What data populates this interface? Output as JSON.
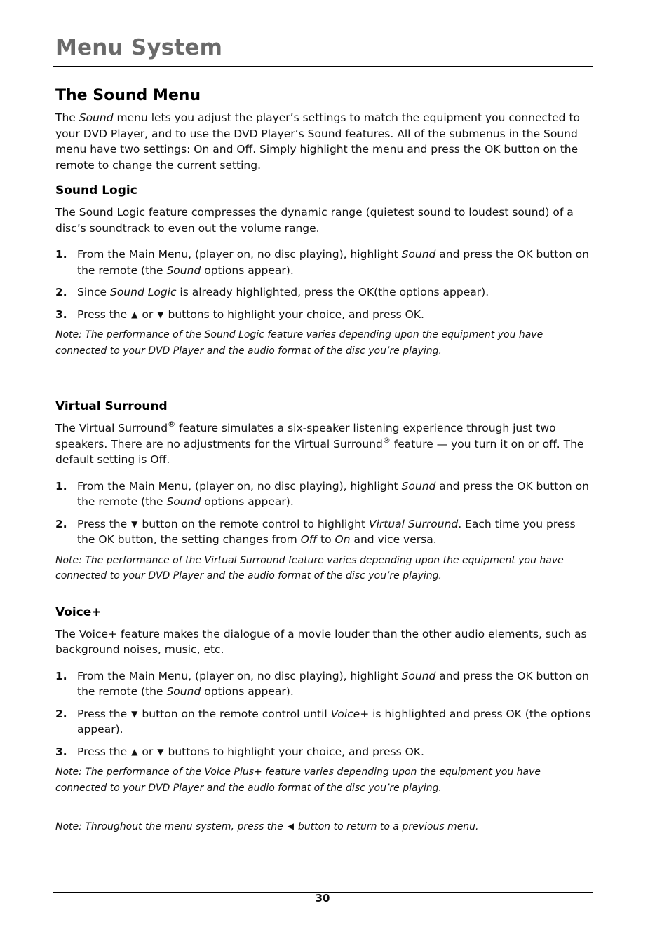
{
  "header": {
    "title": "Menu System"
  },
  "section": {
    "title": "The Sound Menu",
    "intro": {
      "p1": "The ",
      "p1_em": "Sound",
      "p1_rest": " menu lets you adjust the player’s settings to match the equipment you connected to your DVD Player, and to use the DVD Player’s Sound features. All of the submenus in the Sound menu have two settings: On and Off. Simply highlight the menu and press the OK button on the remote to change the current setting."
    }
  },
  "sound_logic": {
    "title": "Sound Logic",
    "description": "The Sound Logic feature compresses the dynamic range (quietest sound to loudest sound) of a disc’s soundtrack to even out the volume range.",
    "steps": [
      {
        "num": "1.",
        "a": "From the Main Menu, (player on, no disc playing), highlight ",
        "em1": "Sound",
        "b": " and press the OK button on the remote (the ",
        "em2": "Sound",
        "c": " options appear)."
      },
      {
        "num": "2.",
        "a": "Since ",
        "em1": "Sound Logic",
        "b": " is already highlighted, press the OK(the options appear)."
      },
      {
        "num": "3.",
        "a": "Press the",
        "mid": "or",
        "b": "buttons to highlight your choice, and press OK."
      }
    ],
    "note": "Note: The performance of the Sound Logic feature varies depending upon the equipment you have connected to your DVD Player and the audio format of the disc you’re playing."
  },
  "virtual_surround": {
    "title": "Virtual Surround",
    "desc_a": "The Virtual Surround",
    "desc_b": " feature simulates a six-speaker listening experience through just two speakers. There are no adjustments for the Virtual Surround",
    "desc_c": " feature — you turn it on or off. The default setting is Off.",
    "reg": "®",
    "steps": [
      {
        "num": "1.",
        "a": "From the Main Menu, (player on, no disc playing), highlight ",
        "em1": "Sound",
        "b": " and press the OK button on the remote (the ",
        "em2": "Sound",
        "c": " options appear)."
      },
      {
        "num": "2.",
        "a": "Press the",
        "b": "button on the remote control to highlight ",
        "em1": "Virtual Surround",
        "c": ". Each time you press the OK button, the setting changes from ",
        "em2": "Off",
        "d": " to ",
        "em3": "On",
        "e": " and vice versa."
      }
    ],
    "note": "Note: The performance of the Virtual Surround feature varies depending upon the equipment you have connected to your DVD Player and the audio format of the disc you’re playing."
  },
  "voice_plus": {
    "title": "Voice+",
    "description": "The Voice+ feature makes the dialogue of a movie louder than the other audio elements, such as background noises, music, etc.",
    "steps": [
      {
        "num": "1.",
        "a": "From the Main Menu, (player on, no disc playing), highlight ",
        "em1": "Sound",
        "b": " and press the OK button on the remote (the ",
        "em2": "Sound",
        "c": " options appear)."
      },
      {
        "num": "2.",
        "a": "Press the",
        "b": "button on the remote control until ",
        "em1": "Voice+",
        "c": " is highlighted and press OK (the options appear)."
      },
      {
        "num": "3.",
        "a": "Press the",
        "mid": "or",
        "b": "buttons to highlight your choice, and press OK."
      }
    ],
    "note": "Note: The performance of the Voice Plus+ feature varies depending upon the equipment you have connected to your DVD Player and the audio format of the disc you’re playing."
  },
  "final_note": {
    "a": "Note: Throughout the menu system, press the",
    "b": "button to return to a previous menu."
  },
  "icons": {
    "up": "▲",
    "down": "▼",
    "left": "◀"
  },
  "footer": {
    "page_number": "30"
  }
}
